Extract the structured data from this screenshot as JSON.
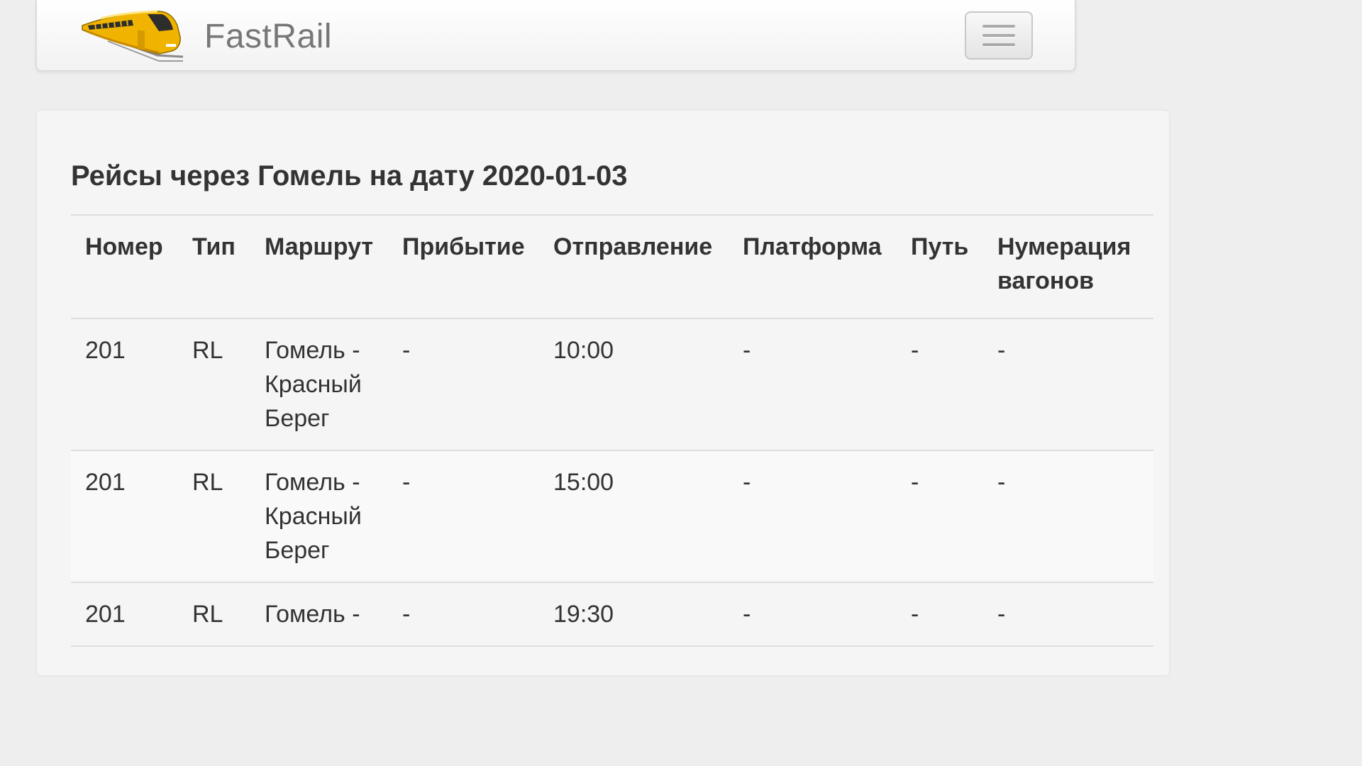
{
  "navbar": {
    "brand_name": "FastRail",
    "logo_icon": "train-icon",
    "menu_icon": "hamburger-menu-icon"
  },
  "page": {
    "title": "Рейсы через Гомель на дату 2020-01-03"
  },
  "table": {
    "headers": {
      "number": "Номер",
      "type": "Тип",
      "route": "Маршрут",
      "arrival": "Прибытие",
      "departure": "Отправление",
      "platform": "Платформа",
      "track": "Путь",
      "car_numbering": "Нумерация вагонов"
    },
    "rows": [
      {
        "number": "201",
        "type": "RL",
        "route": "Гомель - Красный Берег",
        "arrival": "-",
        "departure": "10:00",
        "platform": "-",
        "track": "-",
        "car_numbering": "-"
      },
      {
        "number": "201",
        "type": "RL",
        "route": "Гомель - Красный Берег",
        "arrival": "-",
        "departure": "15:00",
        "platform": "-",
        "track": "-",
        "car_numbering": "-"
      },
      {
        "number": "201",
        "type": "RL",
        "route": "Гомель -",
        "arrival": "-",
        "departure": "19:30",
        "platform": "-",
        "track": "-",
        "car_numbering": "-"
      }
    ]
  },
  "colors": {
    "background": "#eeeeee",
    "panel": "#f5f5f5",
    "brand_text": "#777777",
    "train_yellow": "#f0b400",
    "text": "#333333",
    "border": "#dddddd"
  }
}
